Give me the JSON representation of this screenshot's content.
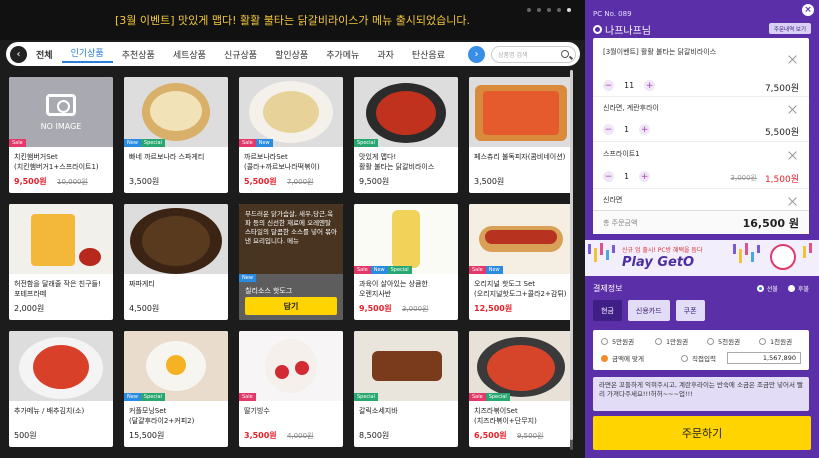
{
  "banner": {
    "text": "[3월 이벤트] 맛있게 맵다! 활활 불타는 닭갈비라이스가 메뉴 출시되었습니다."
  },
  "category": {
    "all_label": "전체",
    "items": [
      "인기상품",
      "추천상품",
      "세트상품",
      "신규상품",
      "할인상품",
      "추가메뉴",
      "과자",
      "탄산음료"
    ],
    "active": "인기상품",
    "search_placeholder": "상품명 검색"
  },
  "products": [
    {
      "name": "치킨햄버거Set\n(치킨햄버거1+스프라이트1)",
      "price": "9,500원",
      "original": "10,000원",
      "badges": [
        "Sale"
      ],
      "image": "no-image",
      "no_image_label": "NO IMAGE",
      "red": true
    },
    {
      "name": "빠네 까르보나라 스파게티",
      "price": "3,500원",
      "badges": [
        "New",
        "Special"
      ],
      "image": "pasta-bowl"
    },
    {
      "name": "까르보나라Set\n(콜라+까르보나라떡볶이)",
      "price": "5,500원",
      "original": "7,000원",
      "badges": [
        "Sale",
        "New"
      ],
      "image": "carbonara",
      "red": true
    },
    {
      "name": "맛있게 맵다!\n활활 불타는 닭갈비라이스",
      "price": "9,500원",
      "badges": [
        "Special"
      ],
      "image": "spicy-chicken-rice"
    },
    {
      "name": "페스츄리 불독피자(콤비네이션)",
      "price": "3,500원",
      "badges": [],
      "image": "pizza"
    },
    {
      "name": "허전함을 달래줄 작은 친구들!\n포테프라떼",
      "price": "2,000원",
      "badges": [],
      "image": "fries"
    },
    {
      "name": "짜파게티",
      "price": "4,500원",
      "badges": [],
      "image": "noodles"
    },
    {
      "name": "칠리소스 핫도그",
      "price": "",
      "badges": [
        "New"
      ],
      "image": "hotdog-promo",
      "promo": true,
      "promo_text": "부드러운 닭가슴살, 새우,당근,옥파 등의 신선한 재료에 오레엔탈 스타일의 달콤한 소스를 넣어 볶아낸 요리입니다. 메뉴",
      "button": "담기"
    },
    {
      "name": "과육이 살아있는 상큼한\n오렌지사반",
      "price": "9,500원",
      "original": "3,000원",
      "badges": [
        "Sale",
        "New",
        "Special"
      ],
      "image": "drink",
      "red": true
    },
    {
      "name": "오리지널 핫도그 Set\n(오리지널핫도그+콜라2+감튀)",
      "price": "12,500원",
      "badges": [
        "Sale",
        "New"
      ],
      "image": "hotdog",
      "red": true
    },
    {
      "name": "추가메뉴 / 배추김치(소)",
      "price": "500원",
      "badges": [],
      "image": "kimchi"
    },
    {
      "name": "커플모닝Set\n(달걀후라이2+커피2)",
      "price": "15,500원",
      "badges": [
        "New",
        "Special"
      ],
      "image": "breakfast"
    },
    {
      "name": "딸기빙수",
      "price": "3,500원",
      "original": "4,000원",
      "badges": [
        "Sale"
      ],
      "image": "strawberry",
      "red": true
    },
    {
      "name": "갈릭소세지바",
      "price": "8,500원",
      "badges": [
        "Special"
      ],
      "image": "sausage"
    },
    {
      "name": "치즈라볶이Set\n(치즈라볶이+단무지)",
      "price": "6,500원",
      "original": "9,500원",
      "badges": [
        "Sale",
        "Special"
      ],
      "image": "rabokki",
      "red": true
    }
  ],
  "panel": {
    "pc_label": "PC No. 089",
    "user": "나프나프님",
    "history_button": "주문내역 보기",
    "orders": [
      {
        "name": "[3월이벤트] 활활 불타는 닭갈비라이스",
        "qty": "11",
        "price": "7,500원"
      },
      {
        "name": "신라면, 계란후라이",
        "qty": "1",
        "price": "5,500원"
      },
      {
        "name": "스프라이트1",
        "qty": "1",
        "price": "1,500원",
        "original": "3,000원"
      },
      {
        "name": "신라면"
      }
    ],
    "total_label": "총 주문금액",
    "total_value": "16,500 원"
  },
  "ad": {
    "line1": "신규 업 출시! PC방 혜택을 듬다",
    "title": "Play GetO"
  },
  "payment": {
    "title": "결제정보",
    "timing": [
      "선불",
      "후불"
    ],
    "tabs": [
      "현금",
      "신용카드",
      "쿠폰"
    ],
    "cash_options": [
      "5만원권",
      "1만원권",
      "5천원권",
      "1천원권"
    ],
    "exact": "금액에 맞게",
    "direct": "직접입력",
    "amount": "1,567,890",
    "memo": "라면은 꼬들하게 익혀주시고, 계란후라이는 반숙에 소금은 조금만 넣어서 빨리 가져다주세요!!!허허~~~업!!!"
  },
  "order_button": "주문하기",
  "colors": {
    "panel": "#5b2fa8",
    "accent": "#ffd400",
    "sale": "#e5386a",
    "new": "#2a8be0",
    "special": "#28a870"
  }
}
